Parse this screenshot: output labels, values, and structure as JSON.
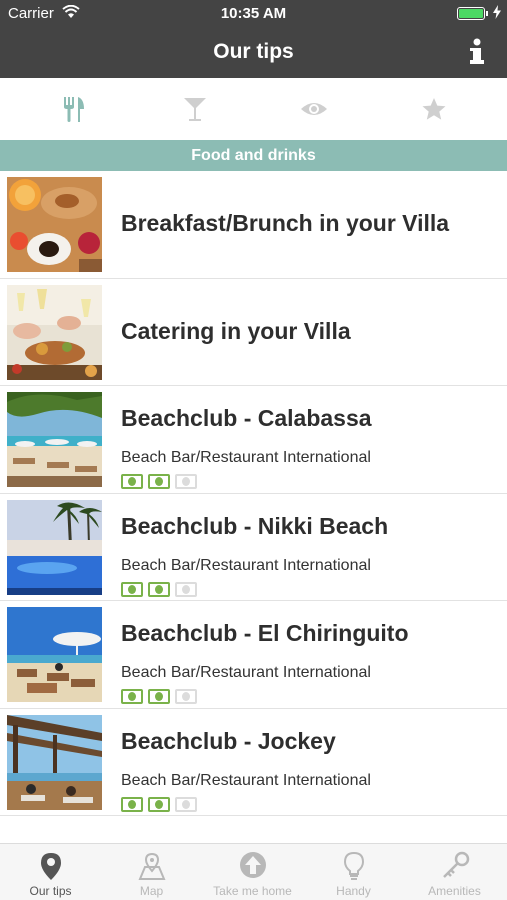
{
  "status_bar": {
    "carrier": "Carrier",
    "time": "10:35 AM"
  },
  "nav": {
    "title": "Our tips",
    "info_icon": "info-icon"
  },
  "categories": [
    {
      "icon": "fork-knife-icon",
      "active": true
    },
    {
      "icon": "cocktail-icon",
      "active": false
    },
    {
      "icon": "eye-icon",
      "active": false
    },
    {
      "icon": "star-icon",
      "active": false
    }
  ],
  "section_title": "Food and drinks",
  "items": [
    {
      "name": "Breakfast/Brunch in your Villa",
      "thumb": "breakfast"
    },
    {
      "name": "Catering in your Villa",
      "thumb": "catering"
    },
    {
      "name": "Beachclub - Calabassa",
      "subtitle": "Beach Bar/Restaurant International",
      "price_level": 2,
      "price_max": 3,
      "thumb": "beach1"
    },
    {
      "name": "Beachclub - Nikki Beach",
      "subtitle": "Beach Bar/Restaurant International",
      "price_level": 2,
      "price_max": 3,
      "thumb": "pool"
    },
    {
      "name": "Beachclub - El Chiringuito",
      "subtitle": "Beach Bar/Restaurant International",
      "price_level": 2,
      "price_max": 3,
      "thumb": "beach2"
    },
    {
      "name": "Beachclub - Jockey",
      "subtitle": "Beach Bar/Restaurant International",
      "price_level": 2,
      "price_max": 3,
      "thumb": "terrace"
    }
  ],
  "tab_bar": [
    {
      "label": "Our tips",
      "icon": "location-pin-icon",
      "active": true
    },
    {
      "label": "Map",
      "icon": "map-icon",
      "active": false
    },
    {
      "label": "Take me home",
      "icon": "home-arrow-icon",
      "active": false
    },
    {
      "label": "Handy",
      "icon": "lightbulb-icon",
      "active": false
    },
    {
      "label": "Amenities",
      "icon": "key-icon",
      "active": false
    }
  ],
  "colors": {
    "bar": "#444444",
    "accent": "#8cbcb4",
    "money": "#7ab24a",
    "tab_inactive": "#b8b8b8"
  }
}
